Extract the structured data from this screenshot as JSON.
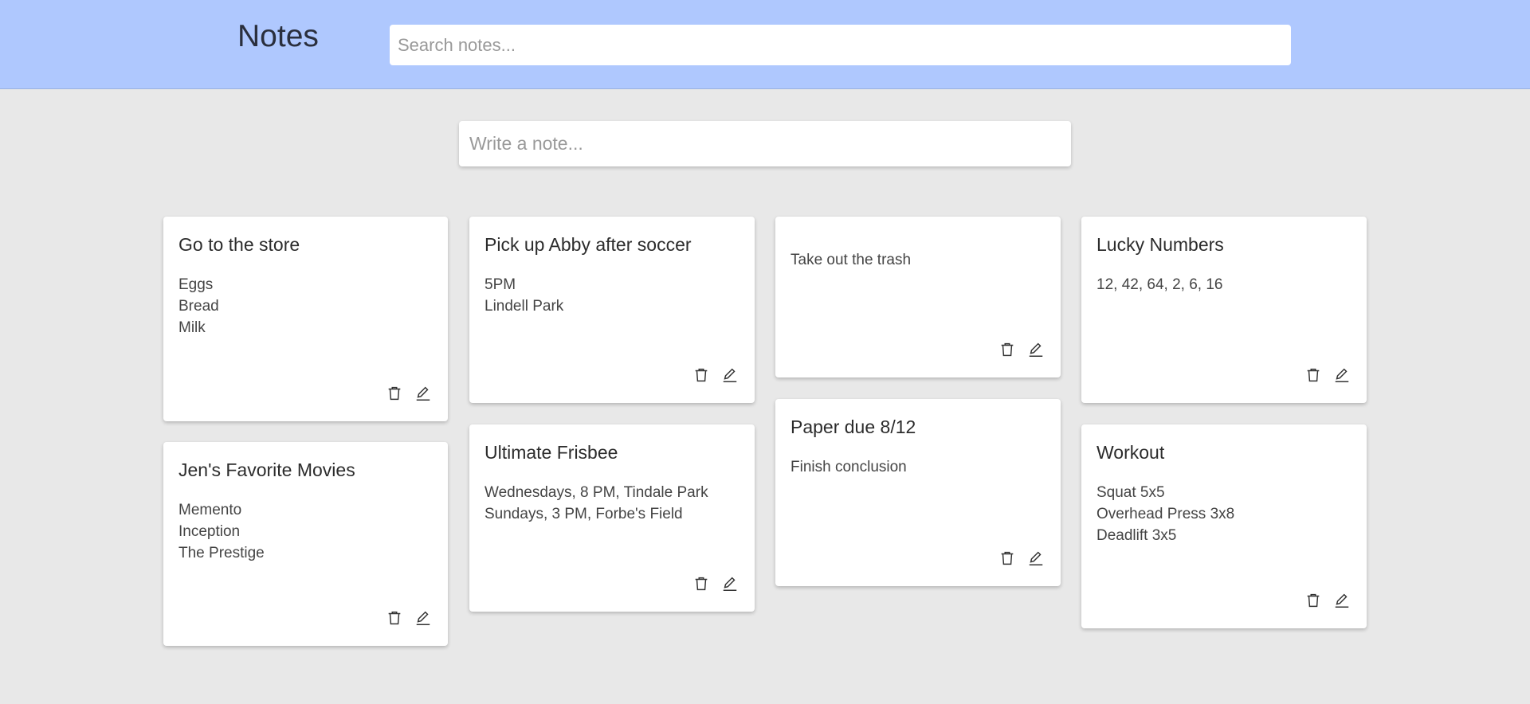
{
  "app": {
    "title": "Notes"
  },
  "search": {
    "placeholder": "Search notes..."
  },
  "compose": {
    "placeholder": "Write a note..."
  },
  "notes": [
    {
      "title": "Go to the store",
      "lines": [
        "Eggs",
        "Bread",
        "Milk"
      ]
    },
    {
      "title": "Jen's Favorite Movies",
      "lines": [
        "Memento",
        "Inception",
        "The Prestige"
      ]
    },
    {
      "title": "Pick up Abby after soccer",
      "lines": [
        "5PM",
        "Lindell Park"
      ]
    },
    {
      "title": "Ultimate Frisbee",
      "lines": [
        "Wednesdays, 8 PM, Tindale Park",
        "Sundays, 3 PM, Forbe's Field"
      ]
    },
    {
      "title": "",
      "lines": [
        "Take out the trash"
      ]
    },
    {
      "title": "Paper due 8/12",
      "lines": [
        "Finish conclusion"
      ]
    },
    {
      "title": "Lucky Numbers",
      "lines": [
        "12, 42, 64, 2, 6, 16"
      ]
    },
    {
      "title": "Workout",
      "lines": [
        "Squat 5x5",
        "Overhead Press 3x8",
        "Deadlift 3x5"
      ]
    }
  ]
}
